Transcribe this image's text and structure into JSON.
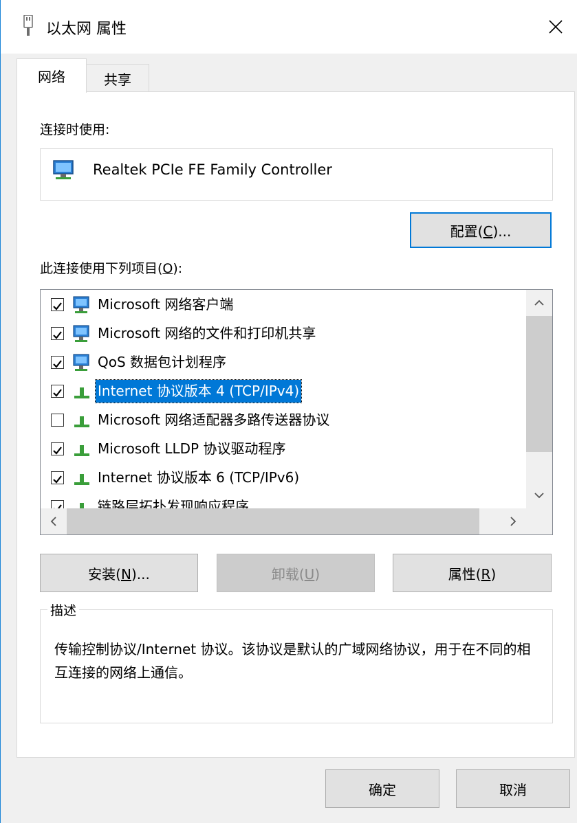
{
  "window": {
    "title": "以太网 属性",
    "icon": "ethernet-icon",
    "close_glyph": "✕"
  },
  "tabs": [
    {
      "label": "网络",
      "active": true
    },
    {
      "label": "共享",
      "active": false
    }
  ],
  "connect_using": {
    "label": "连接时使用:",
    "adapter_name": "Realtek PCIe FE Family Controller",
    "adapter_icon": "network-adapter-icon"
  },
  "configure_button": {
    "text": "配置(",
    "mnemonic": "C",
    "suffix": ")..."
  },
  "items_label": {
    "text": "此连接使用下列项目(",
    "mnemonic": "O",
    "suffix": "):"
  },
  "items": [
    {
      "label": "Microsoft 网络客户端",
      "checked": true,
      "icon": "network-client-icon",
      "selected": false
    },
    {
      "label": "Microsoft 网络的文件和打印机共享",
      "checked": true,
      "icon": "network-client-icon",
      "selected": false
    },
    {
      "label": "QoS 数据包计划程序",
      "checked": true,
      "icon": "network-client-icon",
      "selected": false
    },
    {
      "label": "Internet 协议版本 4 (TCP/IPv4)",
      "checked": true,
      "icon": "protocol-icon",
      "selected": true
    },
    {
      "label": "Microsoft 网络适配器多路传送器协议",
      "checked": false,
      "icon": "protocol-icon",
      "selected": false
    },
    {
      "label": "Microsoft LLDP 协议驱动程序",
      "checked": true,
      "icon": "protocol-icon",
      "selected": false
    },
    {
      "label": "Internet 协议版本 6 (TCP/IPv6)",
      "checked": true,
      "icon": "protocol-icon",
      "selected": false
    },
    {
      "label": "链路层拓扑发现响应程序",
      "checked": true,
      "icon": "protocol-icon",
      "selected": false
    }
  ],
  "buttons": {
    "install": {
      "text": "安装(",
      "mnemonic": "N",
      "suffix": ")..."
    },
    "uninstall": {
      "text": "卸载(",
      "mnemonic": "U",
      "suffix": ")",
      "enabled": false
    },
    "properties": {
      "text": "属性(",
      "mnemonic": "R",
      "suffix": ")"
    }
  },
  "description": {
    "legend": "描述",
    "text": "传输控制协议/Internet 协议。该协议是默认的广域网络协议，用于在不同的相互连接的网络上通信。"
  },
  "footer": {
    "ok": "确定",
    "cancel": "取消"
  },
  "colors": {
    "accent": "#0078d7",
    "window_border": "#1883d7",
    "icon_green": "#3a9e3a",
    "icon_blue": "#2a7fd4"
  }
}
